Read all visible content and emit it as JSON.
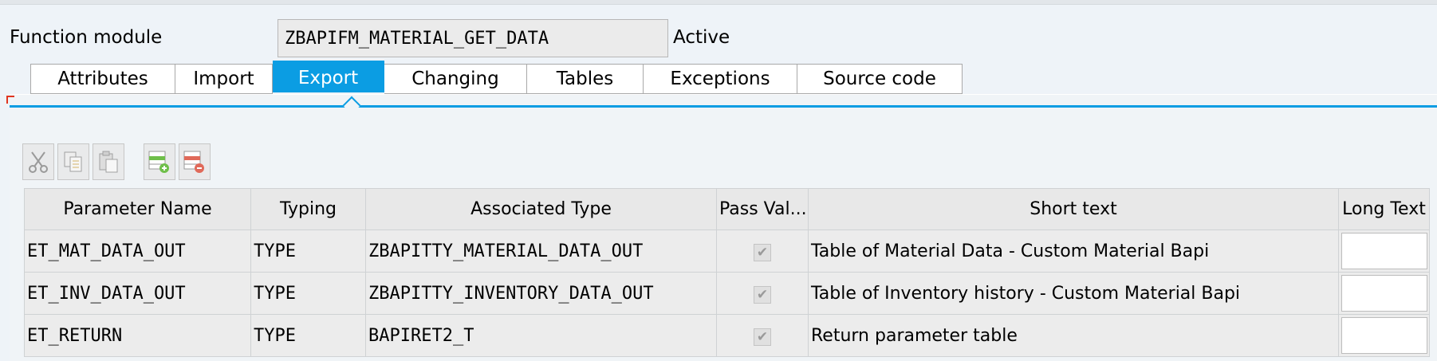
{
  "function_module": {
    "label": "Function module",
    "name": "ZBAPIFM_MATERIAL_GET_DATA",
    "status": "Active"
  },
  "tabs": [
    {
      "label": "Attributes"
    },
    {
      "label": "Import"
    },
    {
      "label": "Export"
    },
    {
      "label": "Changing"
    },
    {
      "label": "Tables"
    },
    {
      "label": "Exceptions"
    },
    {
      "label": "Source code"
    }
  ],
  "active_tab": "Export",
  "toolbar": {
    "icons": [
      "cut-icon",
      "copy-icon",
      "paste-icon",
      "insert-row-icon",
      "delete-row-icon"
    ]
  },
  "table": {
    "headers": {
      "param": "Parameter Name",
      "typing": "Typing",
      "assoc": "Associated Type",
      "pass": "Pass Val...",
      "short": "Short text",
      "long": "Long Text"
    },
    "rows": [
      {
        "param": "ET_MAT_DATA_OUT",
        "typing": "TYPE",
        "assoc": "ZBAPITTY_MATERIAL_DATA_OUT",
        "pass_value": true,
        "short": "Table of Material Data - Custom Material Bapi"
      },
      {
        "param": "ET_INV_DATA_OUT",
        "typing": "TYPE",
        "assoc": "ZBAPITTY_INVENTORY_DATA_OUT",
        "pass_value": true,
        "short": "Table of Inventory history - Custom Material Bapi"
      },
      {
        "param": "ET_RETURN",
        "typing": "TYPE",
        "assoc": "BAPIRET2_T",
        "pass_value": true,
        "short": "Return parameter table"
      }
    ]
  },
  "colors": {
    "accent": "#0b9de3",
    "background": "#eef3f8"
  }
}
